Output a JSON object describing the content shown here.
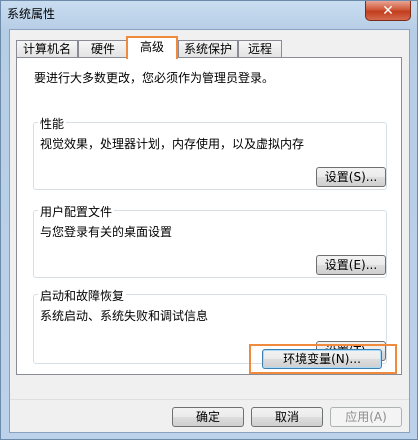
{
  "window": {
    "title": "系统属性",
    "close_glyph": "✕"
  },
  "tabs": [
    {
      "label": "计算机名",
      "active": false
    },
    {
      "label": "硬件",
      "active": false
    },
    {
      "label": "高级",
      "active": true
    },
    {
      "label": "系统保护",
      "active": false
    },
    {
      "label": "远程",
      "active": false
    }
  ],
  "advanced": {
    "intro": "要进行大多数更改，您必须作为管理员登录。",
    "performance": {
      "title": "性能",
      "description": "视觉效果，处理器计划，内存使用，以及虚拟内存",
      "button": "设置(S)..."
    },
    "user_profiles": {
      "title": "用户配置文件",
      "description": "与您登录有关的桌面设置",
      "button": "设置(E)..."
    },
    "startup_recovery": {
      "title": "启动和故障恢复",
      "description": "系统启动、系统失败和调试信息",
      "button": "设置(T)..."
    },
    "env_button": "环境变量(N)..."
  },
  "footer": {
    "ok": "确定",
    "cancel": "取消",
    "apply": "应用(A)"
  },
  "colors": {
    "highlight": "#f08a3c",
    "close_button": "#c13d1d"
  }
}
